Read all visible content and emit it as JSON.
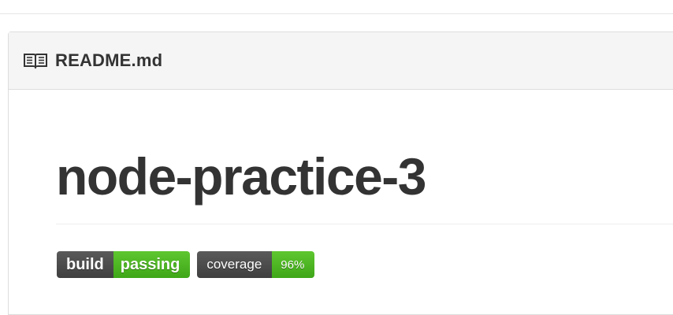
{
  "readme": {
    "header_title": "README.md",
    "icon": "book-icon"
  },
  "content": {
    "title": "node-practice-3",
    "badges": [
      {
        "label": "build",
        "value": "passing",
        "value_color": "#4c1"
      },
      {
        "label": "coverage",
        "value": "96%",
        "value_color": "#4c1"
      }
    ]
  },
  "colors": {
    "header_bg": "#f5f5f5",
    "border": "#dddddd",
    "text": "#333333",
    "badge_dark": "#555555",
    "badge_green": "#4c1"
  }
}
